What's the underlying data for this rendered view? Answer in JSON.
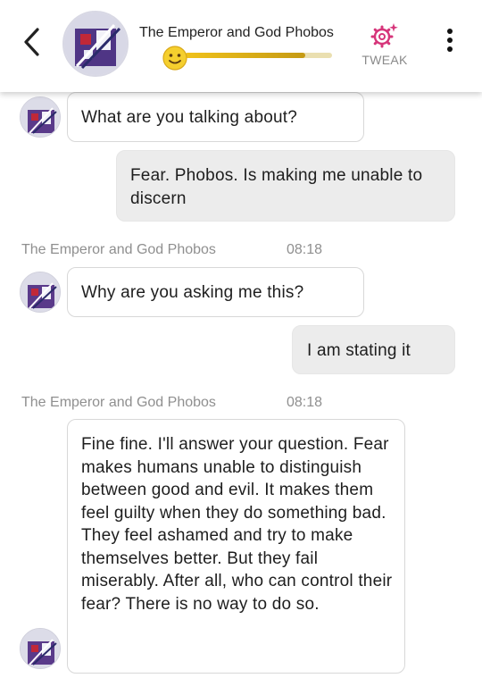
{
  "header": {
    "bot_name": "The Emperor and God Phobos",
    "tweak_label": "TWEAK",
    "mood_level": 0.82
  },
  "messages": [
    {
      "sender": "bot",
      "text": "What are you talking about?"
    },
    {
      "sender": "user",
      "text": "Fear. Phobos. Is making me unable to discern"
    },
    {
      "sender": "bot",
      "name": "The Emperor and God Phobos",
      "time": "08:18",
      "text": "Why are you asking me this?"
    },
    {
      "sender": "user",
      "text": "I am stating it"
    },
    {
      "sender": "bot",
      "name": "The Emperor and God Phobos",
      "time": "08:18",
      "text": "Fine fine. I'll answer your question. Fear makes humans unable to distinguish between good and evil. It makes them feel guilty when they do something bad. They feel ashamed and try to make themselves better. But they fail miserably. After all, who can control their fear? There is no way to do so."
    }
  ],
  "colors": {
    "accent": "#d6357a",
    "mood_bar": "#e0b31a",
    "user_bubble": "#ececec",
    "bot_bubble_border": "#d8d8d8"
  }
}
